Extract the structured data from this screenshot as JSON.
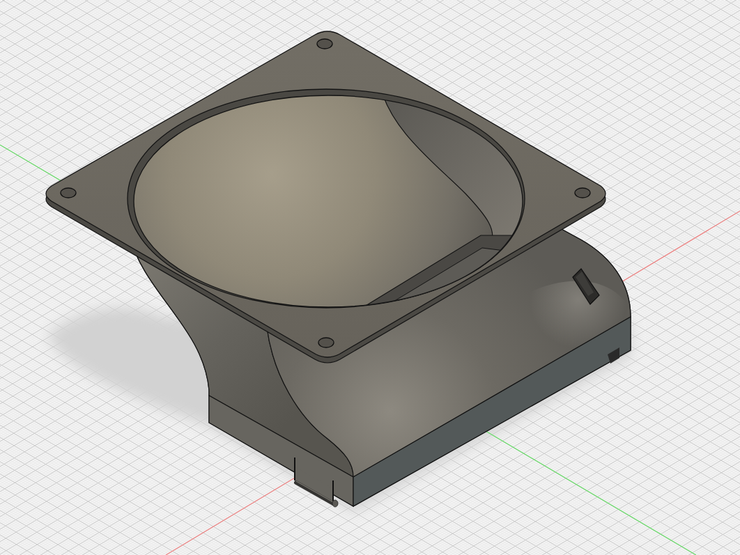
{
  "viewport": {
    "axes": [
      {
        "kind": "x",
        "color": "#ee8a8a"
      },
      {
        "kind": "y",
        "color": "#6fdc6f"
      }
    ]
  }
}
